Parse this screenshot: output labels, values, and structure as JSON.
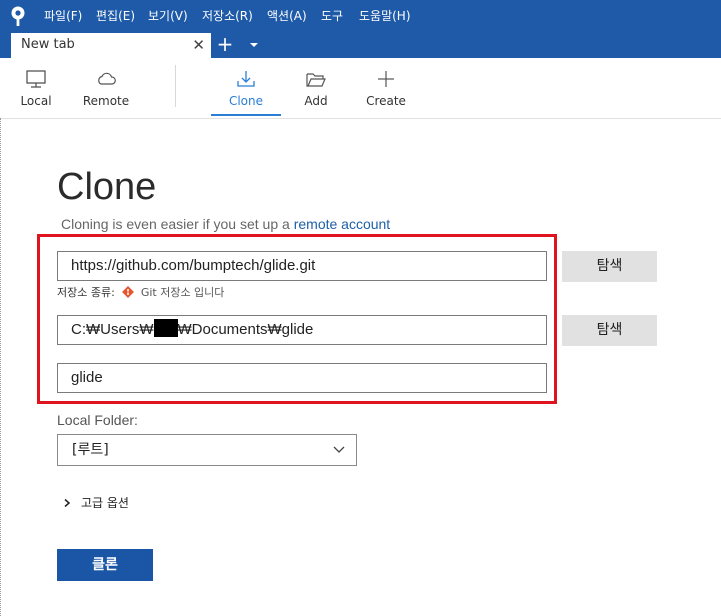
{
  "menu": {
    "items": [
      "파일(F)",
      "편집(E)",
      "보기(V)",
      "저장소(R)",
      "액션(A)",
      "도구",
      "도움말(H)"
    ]
  },
  "tabs": {
    "active_label": "New tab",
    "close_glyph": "✕",
    "add_glyph": "+"
  },
  "toolbar": {
    "local": "Local",
    "remote": "Remote",
    "clone": "Clone",
    "add": "Add",
    "create": "Create"
  },
  "clone": {
    "title": "Clone",
    "subtitle_prefix": "Cloning is even easier if you set up a ",
    "subtitle_link": "remote account",
    "source_url": "https://github.com/bumptech/glide.git",
    "browse_label": "탐색",
    "repo_type_label": "저장소 종류:",
    "repo_type_value": "Git 저장소 입니다",
    "dest_path_prefix": "C:₩Users₩",
    "dest_path_suffix": "₩Documents₩glide",
    "name": "glide",
    "local_folder_label": "Local Folder:",
    "local_folder_value": "[루트]",
    "advanced_label": "고급 옵션",
    "clone_button": "클론"
  },
  "colors": {
    "accent": "#1e5aa8",
    "highlight_border": "#e0141e",
    "active_tab": "#2a7fd4"
  }
}
